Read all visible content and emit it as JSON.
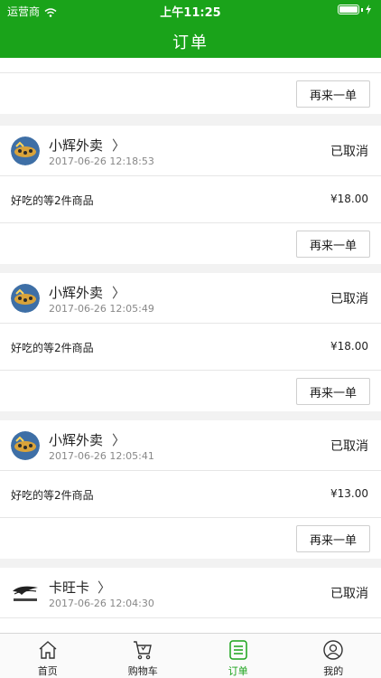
{
  "status_bar": {
    "carrier": "运营商",
    "time": "上午11:25"
  },
  "header": {
    "title": "订单"
  },
  "orders": [
    {
      "reorder_label": "再来一单"
    },
    {
      "shop": "小辉外卖",
      "time": "2017-06-26 12:18:53",
      "status": "已取消",
      "desc": "好吃的等2件商品",
      "price": "¥18.00",
      "reorder_label": "再来一单"
    },
    {
      "shop": "小辉外卖",
      "time": "2017-06-26 12:05:49",
      "status": "已取消",
      "desc": "好吃的等2件商品",
      "price": "¥18.00",
      "reorder_label": "再来一单"
    },
    {
      "shop": "小辉外卖",
      "time": "2017-06-26 12:05:41",
      "status": "已取消",
      "desc": "好吃的等2件商品",
      "price": "¥13.00",
      "reorder_label": "再来一单"
    },
    {
      "shop": "卡旺卡",
      "time": "2017-06-26 12:04:30",
      "status": "已取消"
    }
  ],
  "tabbar": [
    {
      "label": "首页",
      "icon": "home-icon"
    },
    {
      "label": "购物车",
      "icon": "cart-icon"
    },
    {
      "label": "订单",
      "icon": "order-list-icon"
    },
    {
      "label": "我的",
      "icon": "user-icon"
    }
  ],
  "colors": {
    "brand": "#1aa31a",
    "background": "#f2f2f2"
  }
}
